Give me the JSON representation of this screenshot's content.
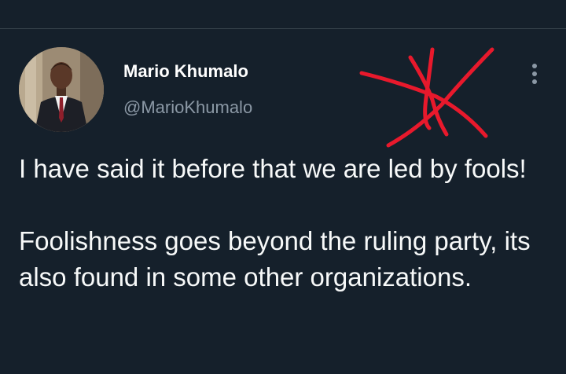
{
  "tweet": {
    "author": {
      "display_name": "Mario Khumalo",
      "handle": "@MarioKhumalo"
    },
    "paragraphs": [
      "I have said it before that we are led by fools!",
      "Foolishness goes beyond the ruling party, its also found in some other organizations."
    ]
  },
  "icons": {
    "more": "more-vertical-icon",
    "avatar": "avatar-photo"
  },
  "colors": {
    "background": "#15202b",
    "divider": "#38444d",
    "text_primary": "#f7f9f9",
    "text_secondary": "#8b98a5",
    "scribble": "#e8192c"
  }
}
